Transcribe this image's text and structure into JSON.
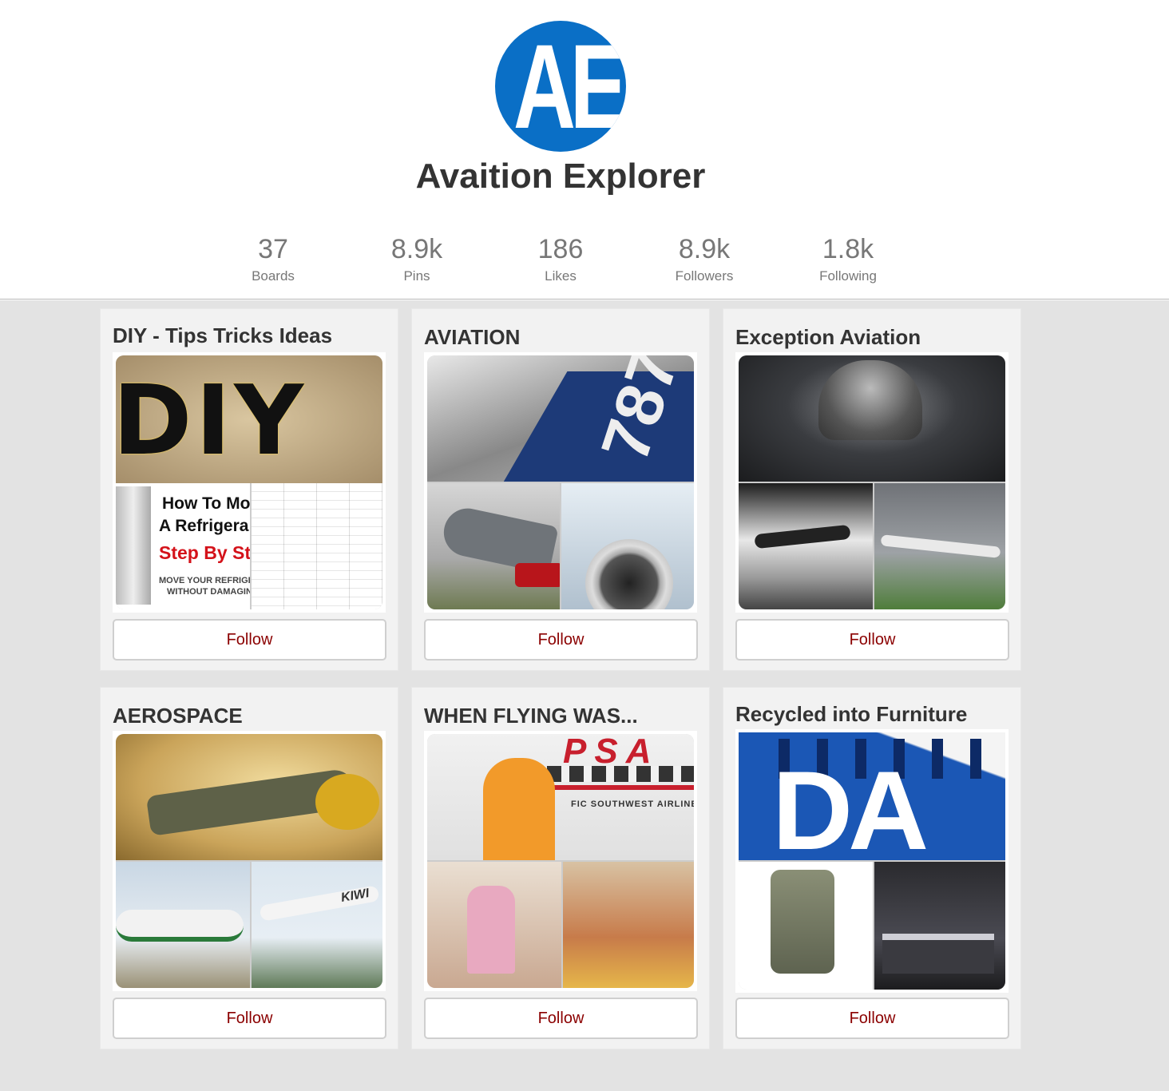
{
  "profile": {
    "logo_text": "AE",
    "name": "Avaition Explorer"
  },
  "stats": [
    {
      "value": "37",
      "label": "Boards"
    },
    {
      "value": "8.9k",
      "label": "Pins"
    },
    {
      "value": "186",
      "label": "Likes"
    },
    {
      "value": "8.9k",
      "label": "Followers"
    },
    {
      "value": "1.8k",
      "label": "Following"
    }
  ],
  "boards": [
    {
      "title": "DIY - Tips Tricks Ideas",
      "follow_label": "Follow"
    },
    {
      "title": "AVIATION",
      "follow_label": "Follow"
    },
    {
      "title": "Exception Aviation",
      "follow_label": "Follow"
    },
    {
      "title": "AEROSPACE",
      "follow_label": "Follow"
    },
    {
      "title": "WHEN FLYING WAS...",
      "follow_label": "Follow"
    },
    {
      "title": "Recycled into Furniture",
      "follow_label": "Follow"
    }
  ],
  "cover_art": {
    "diy_big": "DIY",
    "diy_line1": "How To Mo",
    "diy_line2": "A Refrigera",
    "diy_line3": "Step By St",
    "diy_line4": "MOVE YOUR REFRIGEF",
    "diy_line5": "WITHOUT DAMAGIN",
    "aviation_tail": "787",
    "psa_logo": "PSA",
    "psa_livery": "FIC SOUTHWEST AIRLINES",
    "kiwi_livery": "KIWI",
    "pan_am_letters": "DA"
  },
  "colors": {
    "brand_blue": "#0a6fc6",
    "follow_text": "#8b0000",
    "content_bg": "#e3e3e3"
  }
}
